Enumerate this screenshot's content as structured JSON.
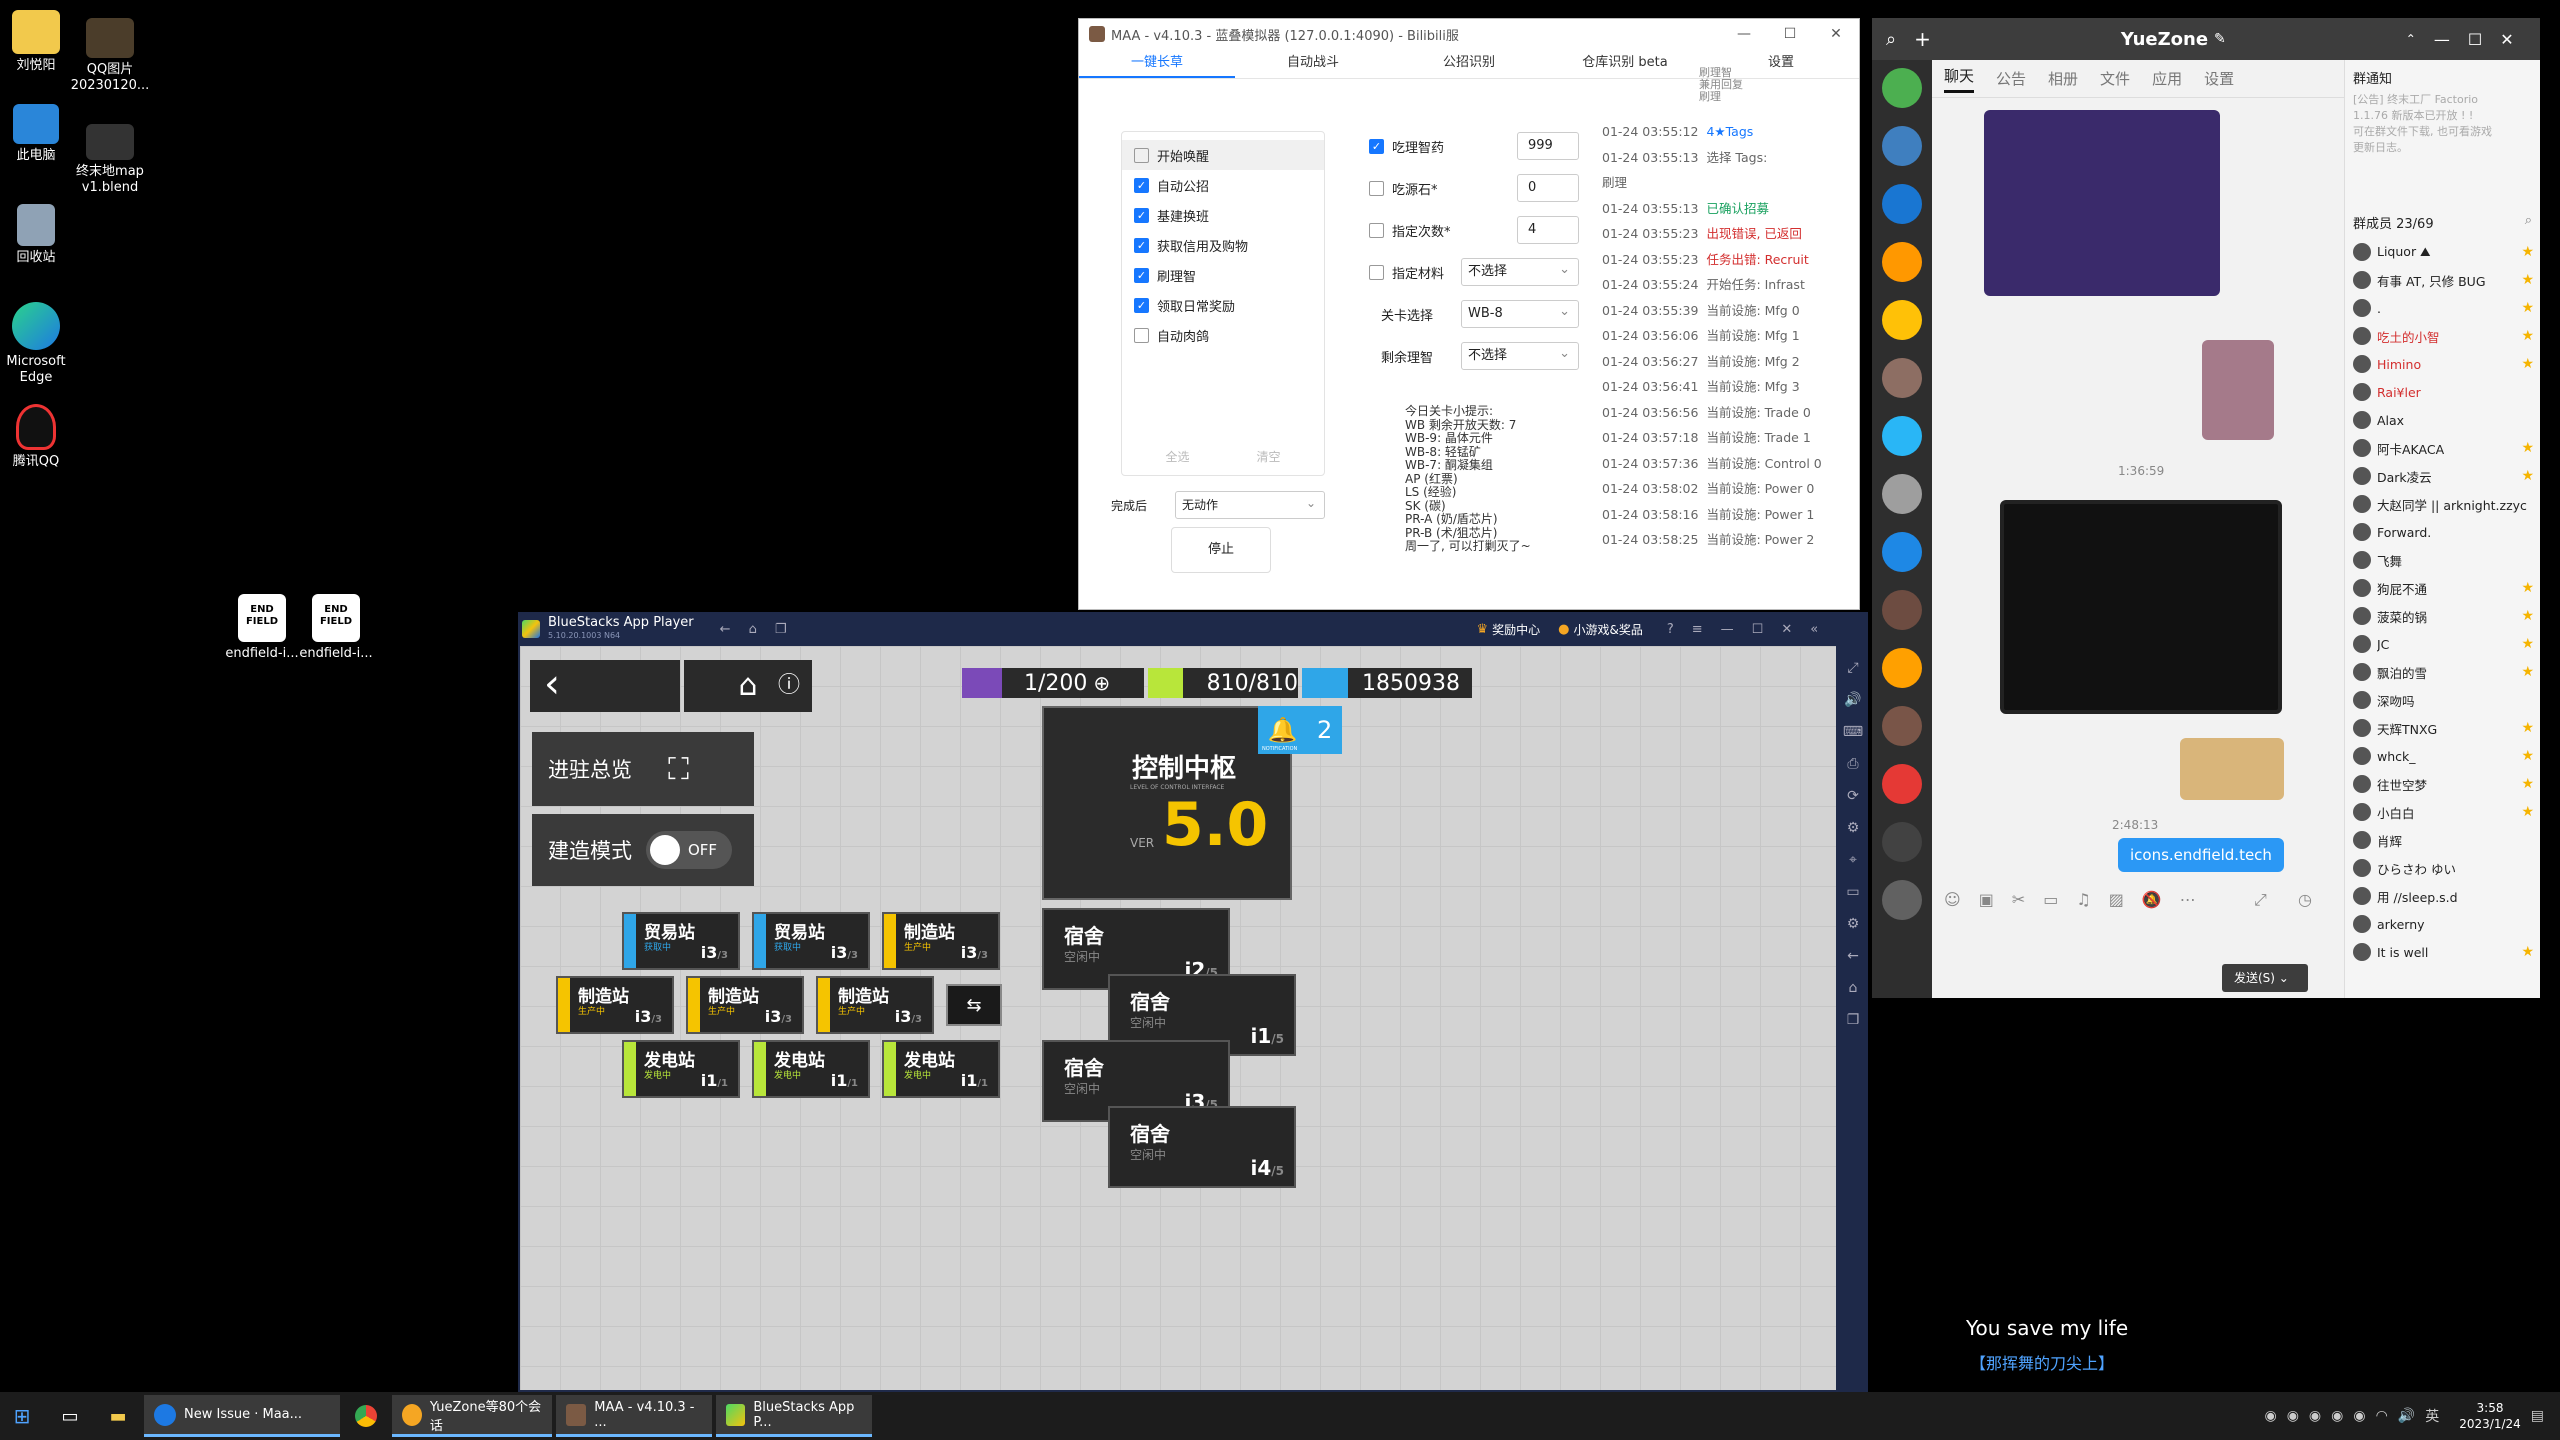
{
  "desktop": {
    "icons": [
      {
        "label": "刘悦阳"
      },
      {
        "label": "QQ图片\n20230120..."
      },
      {
        "label": "此电脑"
      },
      {
        "label": "终末地map\nv1.blend"
      },
      {
        "label": "回收站"
      },
      {
        "label": "Microsoft\nEdge"
      },
      {
        "label": "腾讯QQ"
      },
      {
        "label": "endfield-i..."
      },
      {
        "label": "endfield-i..."
      }
    ]
  },
  "maa": {
    "title": "MAA - v4.10.3 - 蓝叠模拟器 (127.0.0.1:4090) - Bilibili服",
    "tabs": [
      "一键长草",
      "自动战斗",
      "公招识别",
      "仓库识别 beta",
      "设置"
    ],
    "tasks": [
      {
        "label": "开始唤醒",
        "checked": false
      },
      {
        "label": "自动公招",
        "checked": true
      },
      {
        "label": "基建换班",
        "checked": true
      },
      {
        "label": "获取信用及购物",
        "checked": true
      },
      {
        "label": "刷理智",
        "checked": true
      },
      {
        "label": "领取日常奖励",
        "checked": true
      },
      {
        "label": "自动肉鸽",
        "checked": false
      }
    ],
    "select_all": "全选",
    "clear": "清空",
    "after_label": "完成后",
    "after_value": "无动作",
    "stop": "停止",
    "options": [
      {
        "label": "吃理智药",
        "checked": true,
        "value": "999"
      },
      {
        "label": "吃源石*",
        "checked": false,
        "value": "0"
      },
      {
        "label": "指定次数*",
        "checked": false,
        "value": "4"
      },
      {
        "label": "指定材料",
        "checked": false,
        "value": "不选择"
      },
      {
        "label": "关卡选择",
        "value": "WB-8"
      },
      {
        "label": "剩余理智",
        "value": "不选择"
      }
    ],
    "tips": "今日关卡小提示:\nWB 剩余开放天数: 7\nWB-9: 晶体元件\nWB-8: 轻锰矿\nWB-7: 酮凝集组\nAP (红票)\nLS (经验)\nSK (碳)\nPR-A (奶/盾芯片)\nPR-B (术/狙芯片)\n周一了, 可以打剿灭了~",
    "log_header": "刷理智\n兼用回复\n刷理",
    "log": [
      {
        "t": "01-24 03:55:12",
        "m": "4★Tags",
        "c": "#1677ff"
      },
      {
        "t": "01-24 03:55:13",
        "m": "选择 Tags:\n刷理",
        "c": "#666"
      },
      {
        "t": "01-24 03:55:13",
        "m": "已确认招募",
        "c": "#19a15f"
      },
      {
        "t": "01-24 03:55:23",
        "m": "出现错误, 已返回",
        "c": "#d32f2f"
      },
      {
        "t": "01-24 03:55:23",
        "m": "任务出错: Recruit",
        "c": "#d32f2f"
      },
      {
        "t": "01-24 03:55:24",
        "m": "开始任务: Infrast",
        "c": "#666"
      },
      {
        "t": "01-24 03:55:39",
        "m": "当前设施: Mfg 0",
        "c": "#666"
      },
      {
        "t": "01-24 03:56:06",
        "m": "当前设施: Mfg 1",
        "c": "#666"
      },
      {
        "t": "01-24 03:56:27",
        "m": "当前设施: Mfg 2",
        "c": "#666"
      },
      {
        "t": "01-24 03:56:41",
        "m": "当前设施: Mfg 3",
        "c": "#666"
      },
      {
        "t": "01-24 03:56:56",
        "m": "当前设施: Trade 0",
        "c": "#666"
      },
      {
        "t": "01-24 03:57:18",
        "m": "当前设施: Trade 1",
        "c": "#666"
      },
      {
        "t": "01-24 03:57:36",
        "m": "当前设施: Control 0",
        "c": "#666"
      },
      {
        "t": "01-24 03:58:02",
        "m": "当前设施: Power 0",
        "c": "#666"
      },
      {
        "t": "01-24 03:58:16",
        "m": "当前设施: Power 1",
        "c": "#666"
      },
      {
        "t": "01-24 03:58:25",
        "m": "当前设施: Power 2",
        "c": "#666"
      }
    ]
  },
  "bluestacks": {
    "title": "BlueStacks App Player",
    "version": "5.10.20.1003 N64",
    "reward": "奖励中心",
    "games": "小游戏&奖品",
    "game": {
      "drones": "1/200",
      "power": "810/810",
      "lmd": "1850938",
      "overview": "进驻总览",
      "build_mode": "建造模式",
      "build_toggle": "OFF",
      "control": "控制中枢",
      "control_sub": "LEVEL OF CONTROL INTERFACE",
      "control_ver": "VER",
      "control_lv": "5.0",
      "notif_count": "2",
      "notif_label": "NOTIFICATION",
      "rooms": [
        {
          "name": "贸易站",
          "status": "获取中",
          "lv": "i3",
          "max": "/3",
          "color": "#2fa6e8"
        },
        {
          "name": "贸易站",
          "status": "获取中",
          "lv": "i3",
          "max": "/3",
          "color": "#2fa6e8"
        },
        {
          "name": "制造站",
          "status": "生产中",
          "lv": "i3",
          "max": "/3",
          "color": "#f5c400"
        },
        {
          "name": "制造站",
          "status": "生产中",
          "lv": "i3",
          "max": "/3",
          "color": "#f5c400"
        },
        {
          "name": "制造站",
          "status": "生产中",
          "lv": "i3",
          "max": "/3",
          "color": "#f5c400"
        },
        {
          "name": "制造站",
          "status": "生产中",
          "lv": "i3",
          "max": "/3",
          "color": "#f5c400"
        },
        {
          "name": "发电站",
          "status": "发电中",
          "lv": "i1",
          "max": "/1",
          "color": "#b8e63a"
        },
        {
          "name": "发电站",
          "status": "发电中",
          "lv": "i1",
          "max": "/1",
          "color": "#b8e63a"
        },
        {
          "name": "发电站",
          "status": "发电中",
          "lv": "i1",
          "max": "/1",
          "color": "#b8e63a"
        }
      ],
      "dorms": [
        {
          "name": "宿舍",
          "status": "空闲中",
          "lv": "i2",
          "max": "/5"
        },
        {
          "name": "宿舍",
          "status": "空闲中",
          "lv": "i1",
          "max": "/5"
        },
        {
          "name": "宿舍",
          "status": "空闲中",
          "lv": "i3",
          "max": "/5"
        },
        {
          "name": "宿舍",
          "status": "空闲中",
          "lv": "i4",
          "max": "/5"
        }
      ]
    }
  },
  "qq": {
    "title": "YueZone",
    "tabs": [
      "聊天",
      "公告",
      "相册",
      "文件",
      "应用",
      "设置"
    ],
    "bubble_link": "icons.endfield.tech",
    "time1": "1:36:59",
    "time2": "2:48:13",
    "send": "发送(S)",
    "notice_title": "群通知",
    "notice_text": "[公告] 终末工厂 Factorio\n1.1.76 新版本已开放 ! !\n可在群文件下载, 也可看游戏\n更新日志。",
    "members_title": "群成员 23/69",
    "members": [
      {
        "name": "Liquor ⛰",
        "c": "#222"
      },
      {
        "name": "有事 AT, 只修 BUG",
        "c": "#222"
      },
      {
        "name": ".",
        "c": "#222"
      },
      {
        "name": "吃土的小智",
        "c": "#d32f2f"
      },
      {
        "name": "Himino",
        "c": "#d32f2f"
      },
      {
        "name": "Rai¥ler",
        "c": "#d32f2f"
      },
      {
        "name": "Alax",
        "c": "#222"
      },
      {
        "name": "阿卡AKACA",
        "c": "#222"
      },
      {
        "name": "Dark凌云",
        "c": "#222"
      },
      {
        "name": "大赵同学 || arknight.zzych",
        "c": "#222"
      },
      {
        "name": "Forward.",
        "c": "#222"
      },
      {
        "name": "飞舞",
        "c": "#222"
      },
      {
        "name": "狗屁不通",
        "c": "#222"
      },
      {
        "name": "菠菜的锅",
        "c": "#222"
      },
      {
        "name": "JC",
        "c": "#222"
      },
      {
        "name": "飘泊的雪",
        "c": "#222"
      },
      {
        "name": "深吻吗",
        "c": "#222"
      },
      {
        "name": "天辉TNXG",
        "c": "#222"
      },
      {
        "name": "whck_",
        "c": "#222"
      },
      {
        "name": "往世空梦",
        "c": "#222"
      },
      {
        "name": "小白白",
        "c": "#222"
      },
      {
        "name": "肖辉",
        "c": "#222"
      },
      {
        "name": "ひらさわ ゆい",
        "c": "#222"
      },
      {
        "name": "用 //sleep.s.d",
        "c": "#222"
      },
      {
        "name": "arkerny",
        "c": "#222"
      },
      {
        "name": "It is well",
        "c": "#222"
      }
    ],
    "stars": [
      0,
      1,
      2,
      3,
      4,
      7,
      8,
      12,
      13,
      14,
      15,
      17,
      18,
      19,
      20,
      25
    ]
  },
  "overlay": {
    "line1": "You save my life",
    "line2": "【那挥舞的刀尖上】"
  },
  "taskbar": {
    "items": [
      {
        "label": "New Issue · Maa..."
      },
      {
        "label": ""
      },
      {
        "label": "YueZone等80个会话"
      },
      {
        "label": "MAA - v4.10.3 - ..."
      },
      {
        "label": "BlueStacks App P..."
      }
    ],
    "time": "3:58",
    "date": "2023/1/24"
  }
}
